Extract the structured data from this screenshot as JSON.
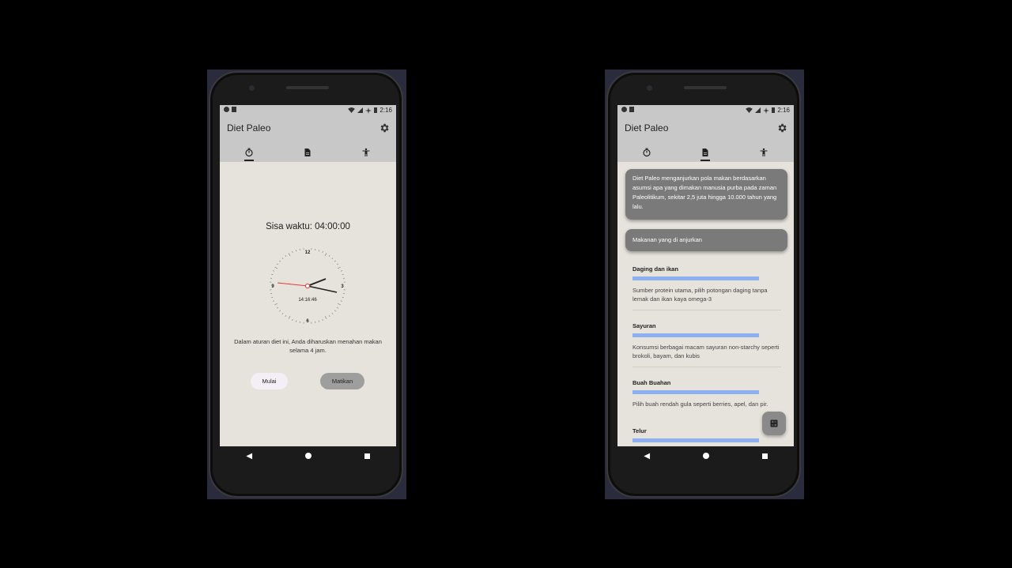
{
  "phones": [
    {
      "status_time": "2:16",
      "app_title": "Diet Paleo",
      "active_tab": 0,
      "timer": {
        "remaining_label": "Sisa waktu: 04:00:00",
        "digital_time": "14:16:46",
        "clock_numbers": {
          "twelve": "12",
          "three": "3",
          "six": "6",
          "nine": "9"
        },
        "description": "Dalam aturan diet ini, Anda diharuskan menahan makan selama 4 jam.",
        "start_button": "Mulai",
        "stop_button": "Matikan"
      }
    },
    {
      "status_time": "2:16",
      "app_title": "Diet Paleo",
      "active_tab": 1,
      "info": {
        "intro": "Diet Paleo menganjurkan pola makan berdasarkan asumsi apa yang dimakan manusia purba pada zaman Paleolitikum, sekitar 2,5 juta hingga 10.000 tahun yang lalu.",
        "recommended_header": "Makanan yang di anjurkan",
        "foods": [
          {
            "name": "Daging dan ikan",
            "text": "Sumber protein utama, pilih potongan daging tanpa lemak dan ikan kaya omega-3"
          },
          {
            "name": "Sayuran",
            "text": "Konsumsi berbagai macam sayuran non-starchy seperti brokoli, bayam, dan kubis"
          },
          {
            "name": "Buah Buahan",
            "text": "Pilih buah rendah gula seperti berries, apel, dan pir."
          },
          {
            "name": "Telur",
            "text": ""
          }
        ]
      }
    }
  ],
  "icons": {
    "tab_timer": "stopwatch-icon",
    "tab_info": "document-icon",
    "tab_body": "person-icon",
    "settings": "gear-icon",
    "fab": "calculator-icon"
  },
  "colors": {
    "appbar": "#c8c8c8",
    "screen_bg": "#e6e2dc",
    "card": "#7a7a7a",
    "progress": "#8fb0f0",
    "second_hand": "#e53935"
  }
}
